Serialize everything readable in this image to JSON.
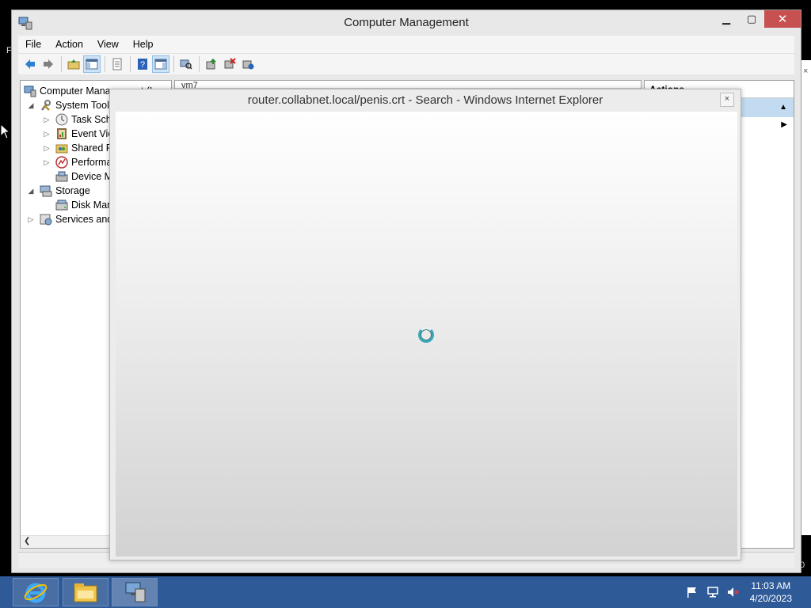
{
  "side": {
    "left_char": "F",
    "right_char": "0"
  },
  "window": {
    "title": "Computer Management"
  },
  "menu": {
    "items": [
      "File",
      "Action",
      "View",
      "Help"
    ]
  },
  "tree": {
    "items": [
      {
        "label": "Computer Management (Local",
        "icon": "computer-icon",
        "arrow": "",
        "indent": 0
      },
      {
        "label": "System Tools",
        "icon": "tools-icon",
        "arrow": "expanded",
        "indent": 1
      },
      {
        "label": "Task Sche",
        "icon": "clock-icon",
        "arrow": "collapsed",
        "indent": 2
      },
      {
        "label": "Event Vie",
        "icon": "event-viewer-icon",
        "arrow": "collapsed",
        "indent": 2
      },
      {
        "label": "Shared Fo",
        "icon": "shared-folders-icon",
        "arrow": "collapsed",
        "indent": 2
      },
      {
        "label": "Performa",
        "icon": "performance-icon",
        "arrow": "collapsed",
        "indent": 2
      },
      {
        "label": "Device M",
        "icon": "device-manager-icon",
        "arrow": "",
        "indent": 2
      },
      {
        "label": "Storage",
        "icon": "storage-icon",
        "arrow": "expanded",
        "indent": 1
      },
      {
        "label": "Disk Man",
        "icon": "disk-icon",
        "arrow": "",
        "indent": 2
      },
      {
        "label": "Services and",
        "icon": "services-icon",
        "arrow": "collapsed",
        "indent": 1
      }
    ]
  },
  "center": {
    "header_text": "vm7"
  },
  "actions": {
    "header": "Actions"
  },
  "dialog": {
    "title": "router.collabnet.local/penis.crt - Search - Windows Internet Explorer",
    "close_label": "×"
  },
  "tray": {
    "time": "11:03 AM",
    "date": "4/20/2023"
  },
  "colors": {
    "taskbar": "#2f5a98",
    "spinner": "#3aa8b8",
    "close_button": "#c75050",
    "selection": "#c2dbf0"
  }
}
